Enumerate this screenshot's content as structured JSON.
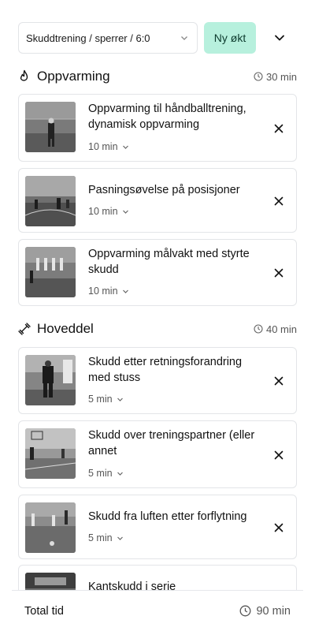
{
  "header": {
    "session_select": "Skuddtrening / sperrer / 6:0",
    "new_session_label": "Ny økt"
  },
  "sections": [
    {
      "title": "Oppvarming",
      "icon": "flame-icon",
      "time": "30 min",
      "items": [
        {
          "title": "Oppvarming til håndballtrening, dynamisk oppvarming",
          "duration": "10 min"
        },
        {
          "title": "Pasningsøvelse på posisjoner",
          "duration": "10 min"
        },
        {
          "title": "Oppvarming målvakt med styrte skudd",
          "duration": "10 min"
        }
      ]
    },
    {
      "title": "Hoveddel",
      "icon": "dumbbell-icon",
      "time": "40 min",
      "items": [
        {
          "title": "Skudd etter retningsforandring med stuss",
          "duration": "5 min"
        },
        {
          "title": "Skudd over treningspartner (eller annet",
          "duration": "5 min"
        },
        {
          "title": "Skudd fra luften etter forflytning",
          "duration": "5 min"
        },
        {
          "title": "Kantskudd i serie",
          "duration": ""
        }
      ]
    }
  ],
  "footer": {
    "total_label": "Total tid",
    "total_time": "90 min"
  }
}
